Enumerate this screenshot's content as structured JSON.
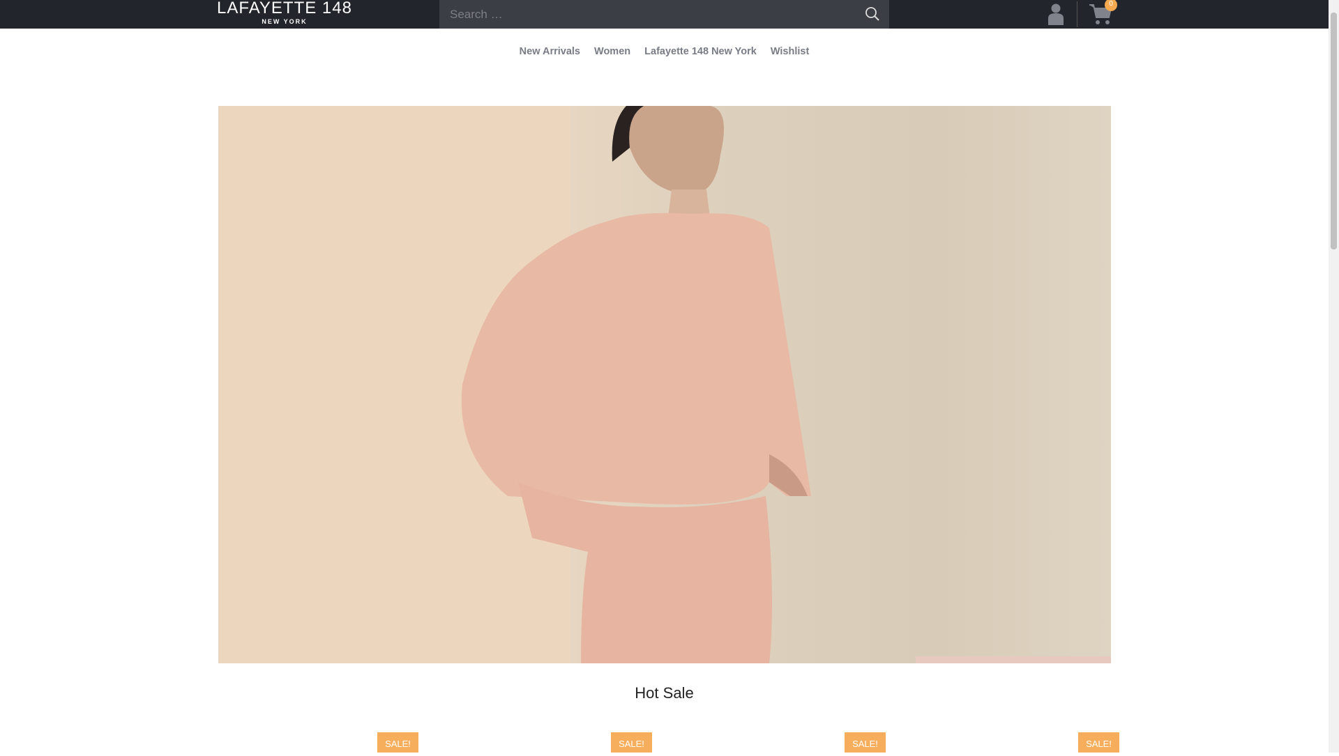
{
  "header": {
    "logo_main": "LAFAYETTE 148",
    "logo_sub": "NEW YORK",
    "search_placeholder": "Search …",
    "cart_count": "0"
  },
  "nav": {
    "items": [
      "New Arrivals",
      "Women",
      "Lafayette 148 New York",
      "Wishlist"
    ]
  },
  "section": {
    "title": "Hot Sale"
  },
  "products": [
    {
      "badge": "SALE!"
    },
    {
      "badge": "SALE!"
    },
    {
      "badge": "SALE!"
    },
    {
      "badge": "SALE!"
    }
  ],
  "colors": {
    "topbar": "#23252c",
    "accent": "#f6ae5c"
  }
}
